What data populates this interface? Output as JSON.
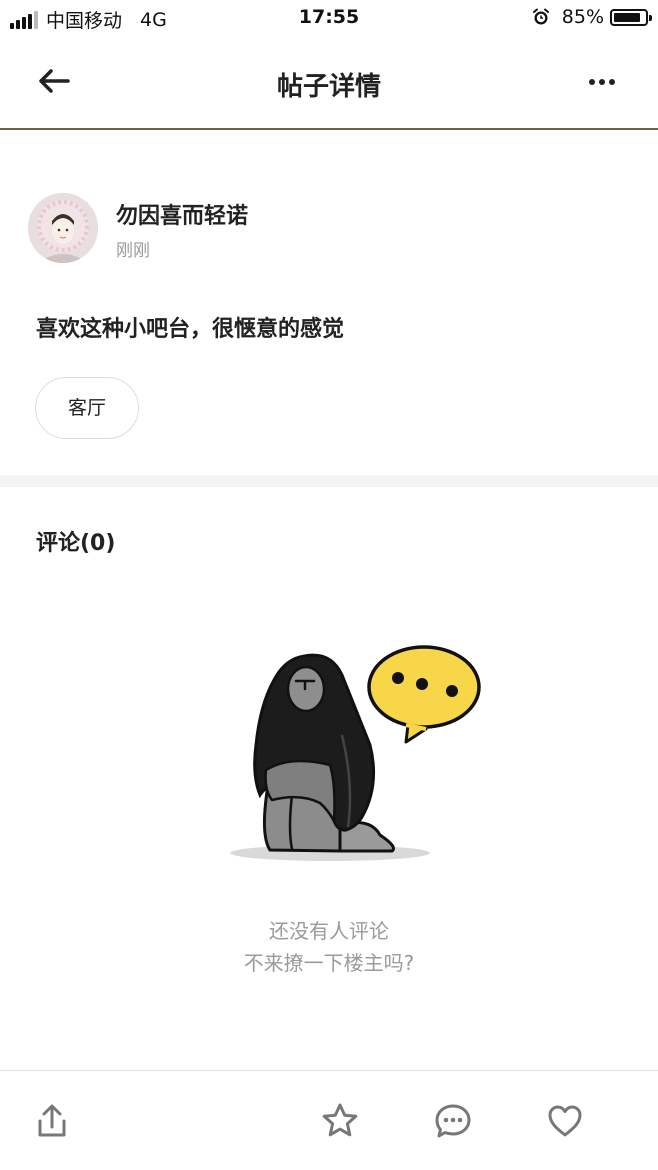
{
  "status_bar": {
    "carrier": "中国移动",
    "network": "4G",
    "time": "17:55",
    "battery": "85%",
    "battery_level": 0.85
  },
  "nav": {
    "title": "帖子详情",
    "back_icon": "back-arrow-icon",
    "more_icon": "more-dots-icon"
  },
  "post": {
    "author": "勿因喜而轻诺",
    "time": "刚刚",
    "content": "喜欢这种小吧台，很惬意的感觉",
    "tag": "客厅"
  },
  "comments": {
    "title": "评论(0)",
    "empty_line1": "还没有人评论",
    "empty_line2": "不来撩一下楼主吗?"
  },
  "bottom_bar": {
    "icons": [
      "share-icon",
      "star-icon",
      "comment-icon",
      "heart-icon"
    ]
  },
  "colors": {
    "nav_border": "#6e5f47",
    "bubble_yellow": "#f7d64a",
    "muted_text": "#9a9a9a"
  }
}
